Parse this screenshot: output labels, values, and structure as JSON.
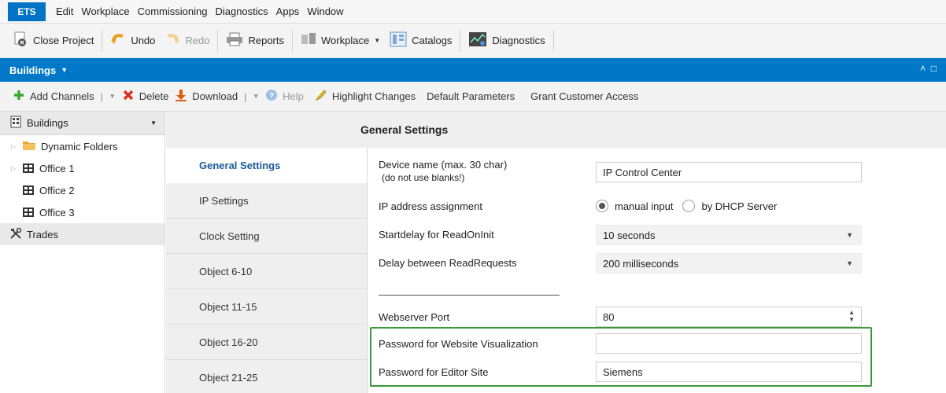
{
  "menubar": {
    "logo": "ETS",
    "items": [
      "Edit",
      "Workplace",
      "Commissioning",
      "Diagnostics",
      "Apps",
      "Window"
    ]
  },
  "toolbar": {
    "close_project": "Close Project",
    "undo": "Undo",
    "redo": "Redo",
    "reports": "Reports",
    "workplace": "Workplace",
    "catalogs": "Catalogs",
    "diagnostics": "Diagnostics"
  },
  "buildings_bar": {
    "title": "Buildings"
  },
  "actionbar": {
    "add_channels": "Add Channels",
    "delete": "Delete",
    "download": "Download",
    "help": "Help",
    "highlight_changes": "Highlight Changes",
    "default_parameters": "Default Parameters",
    "grant_customer_access": "Grant Customer Access"
  },
  "tree": {
    "header": "Buildings",
    "items": [
      {
        "label": "Dynamic Folders"
      },
      {
        "label": "Office 1"
      },
      {
        "label": "Office 2"
      },
      {
        "label": "Office 3"
      }
    ],
    "trades": "Trades"
  },
  "content": {
    "title": "General Settings",
    "tabs": [
      {
        "label": "General Settings"
      },
      {
        "label": "IP Settings"
      },
      {
        "label": "Clock Setting"
      },
      {
        "label": "Object 6-10"
      },
      {
        "label": "Object 11-15"
      },
      {
        "label": "Object 16-20"
      },
      {
        "label": "Object 21-25"
      }
    ]
  },
  "form": {
    "device_name": {
      "label_line1": "Device name (max. 30 char)",
      "label_line2": "(do not use blanks!)",
      "value": "IP Control Center"
    },
    "ip_assignment": {
      "label": "IP address assignment",
      "option1": "manual input",
      "option2": "by DHCP Server"
    },
    "startdelay": {
      "label": "Startdelay for ReadOnInit",
      "value": "10 seconds"
    },
    "delay_read": {
      "label": "Delay between ReadRequests",
      "value": "200 milliseconds"
    },
    "webserver_port": {
      "label": "Webserver Port",
      "value": "80"
    },
    "pw_visualization": {
      "label": "Password for Website Visualization",
      "value": ""
    },
    "pw_editor": {
      "label": "Password for Editor Site",
      "value": "Siemens"
    }
  }
}
